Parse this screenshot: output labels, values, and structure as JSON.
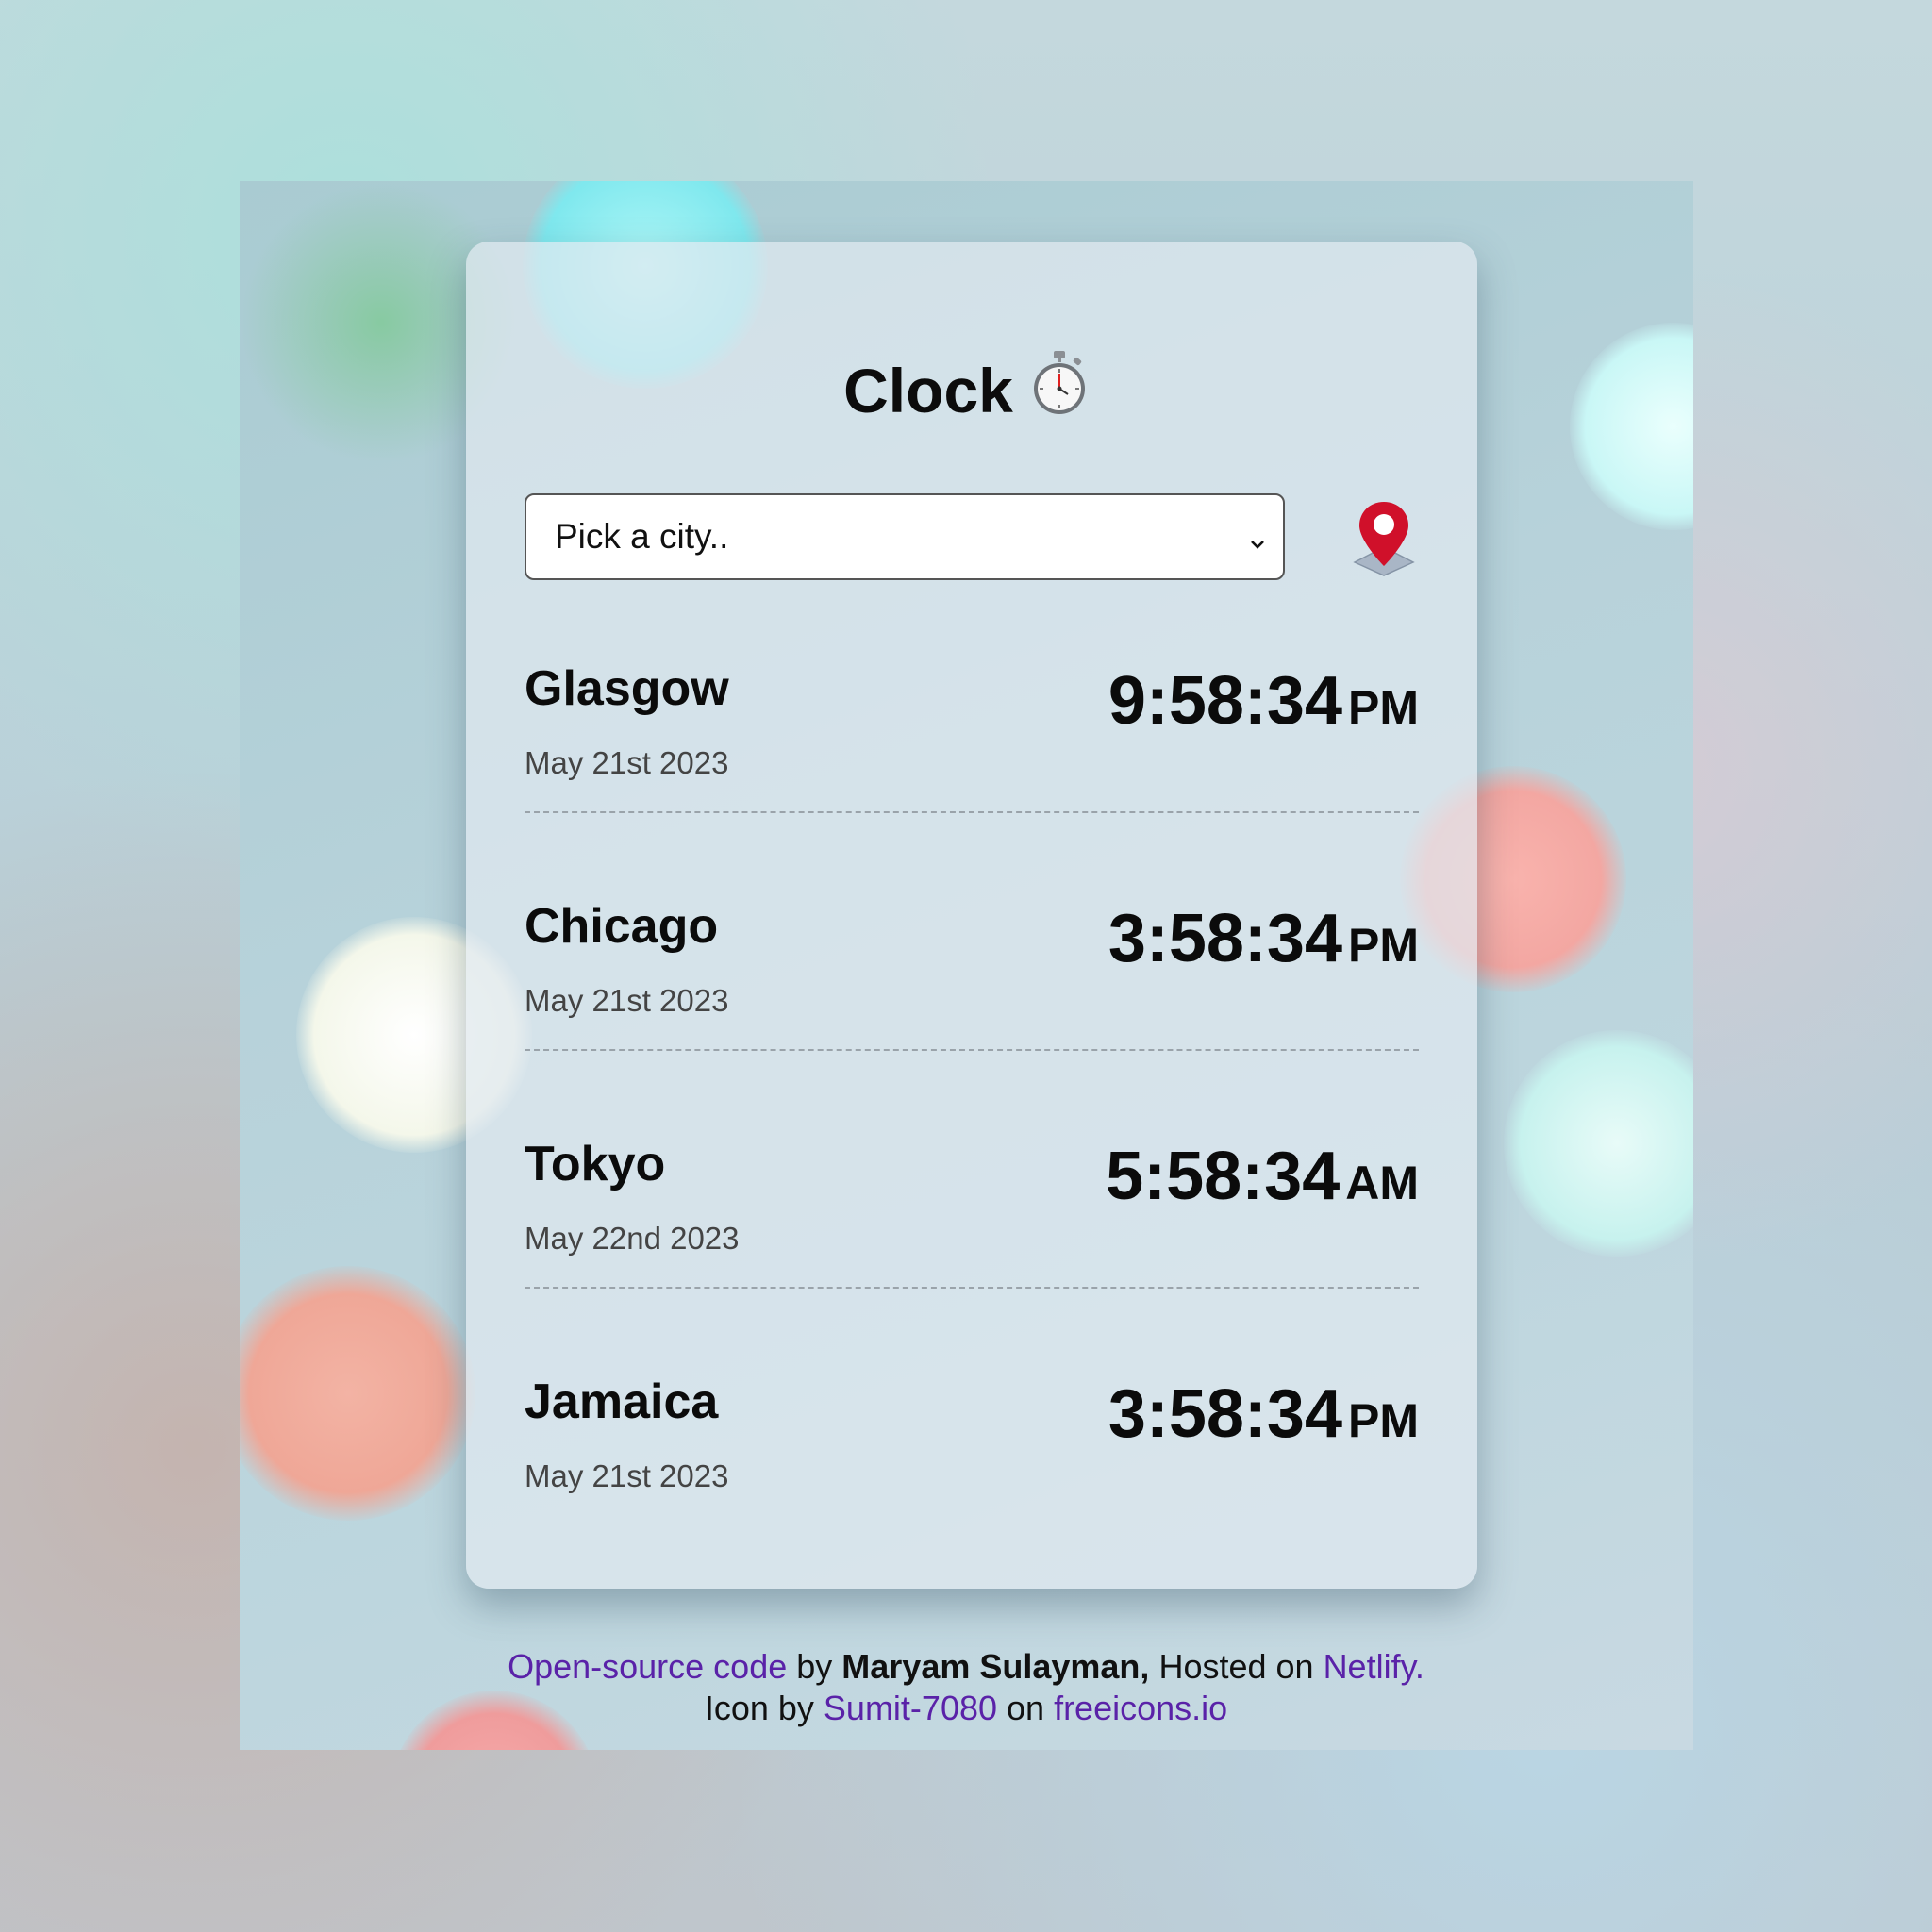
{
  "app": {
    "title": "Clock",
    "title_icon": "stopwatch-icon"
  },
  "city_select": {
    "value": "Pick a city..",
    "icon": "chevron-down-icon"
  },
  "location_button": {
    "icon": "location-pin-icon"
  },
  "cities": [
    {
      "name": "Glasgow",
      "date": "May 21st 2023",
      "time": "9:58:34",
      "ampm": "PM"
    },
    {
      "name": "Chicago",
      "date": "May 21st 2023",
      "time": "3:58:34",
      "ampm": "PM"
    },
    {
      "name": "Tokyo",
      "date": "May 22nd 2023",
      "time": "5:58:34",
      "ampm": "AM"
    },
    {
      "name": "Jamaica",
      "date": "May 21st 2023",
      "time": "3:58:34",
      "ampm": "PM"
    }
  ],
  "footer": {
    "source_link": "Open-source code",
    "by": " by ",
    "author": "Maryam Sulayman,",
    "hosted": " Hosted on ",
    "host_link": "Netlify.",
    "icon_by": "Icon by ",
    "icon_author_link": "Sumit-7080",
    "on": " on ",
    "icon_site_link": "freeicons.io"
  },
  "colors": {
    "link": "#5a22a8",
    "pin_red": "#d0102a"
  }
}
